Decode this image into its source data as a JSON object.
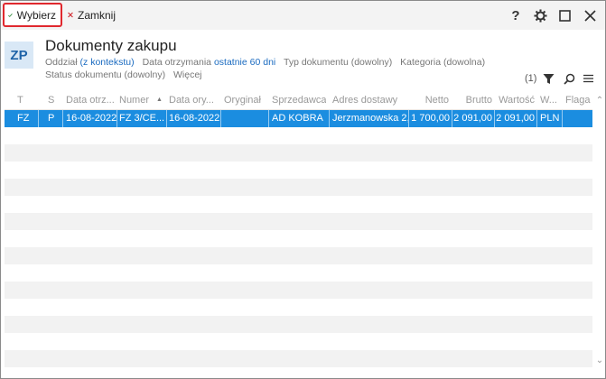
{
  "toolbar": {
    "select_label": "Wybierz",
    "close_label": "Zamknij"
  },
  "window_icons": [
    "help-icon",
    "gear-icon",
    "maximize-icon",
    "close-icon"
  ],
  "header": {
    "badge": "ZP",
    "title": "Dokumenty zakupu",
    "filters_line1": [
      {
        "label": "Oddział",
        "value": "(z kontekstu)"
      },
      {
        "label": "Data otrzymania",
        "value": "ostatnie 60 dni"
      },
      {
        "label": "Typ dokumentu (dowolny)",
        "value": ""
      },
      {
        "label": "Kategoria (dowolna)",
        "value": ""
      }
    ],
    "filters_line2": [
      {
        "label": "Status dokumentu (dowolny)",
        "value": ""
      },
      {
        "label": "Więcej",
        "value": ""
      }
    ],
    "filter_count": "(1)"
  },
  "grid": {
    "columns": [
      "T",
      "S",
      "Data otrz...",
      "Numer",
      "Data ory...",
      "Oryginał",
      "Sprzedawca",
      "Adres dostawy",
      "Netto",
      "Brutto",
      "Wartość",
      "W...",
      "Flaga"
    ],
    "sort_column": "Numer",
    "rows": [
      [
        "FZ",
        "P",
        "16-08-2022",
        "FZ 3/CE...",
        "16-08-2022",
        "",
        "AD KOBRA",
        "Jerzmanowska 2,...",
        "1 700,00",
        "2 091,00",
        "2 091,00",
        "PLN",
        ""
      ]
    ]
  },
  "colors": {
    "accent": "#1b8de0",
    "highlight_border": "#e0282e",
    "link": "#1b6bc0",
    "check": "#2e8b3a",
    "cross": "#d0262d"
  }
}
